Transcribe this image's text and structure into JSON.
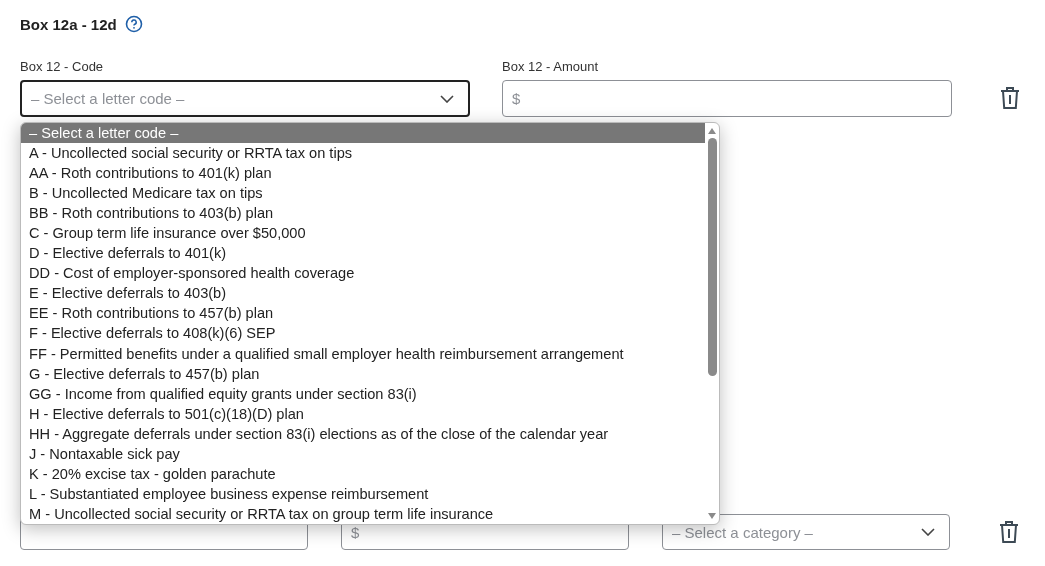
{
  "section": {
    "title": "Box 12a - 12d"
  },
  "code_field": {
    "label": "Box 12 - Code",
    "placeholder": "– Select a letter code –",
    "expanded": true
  },
  "amount_field": {
    "label": "Box 12 - Amount",
    "placeholder": "$"
  },
  "dropdown": {
    "options": [
      {
        "label": "– Select a letter code –",
        "selected": true
      },
      {
        "label": "A - Uncollected social security or RRTA tax on tips",
        "selected": false
      },
      {
        "label": "AA - Roth contributions to 401(k) plan",
        "selected": false
      },
      {
        "label": "B - Uncollected Medicare tax on tips",
        "selected": false
      },
      {
        "label": "BB - Roth contributions to 403(b) plan",
        "selected": false
      },
      {
        "label": "C - Group term life insurance over $50,000",
        "selected": false
      },
      {
        "label": "D - Elective deferrals to 401(k)",
        "selected": false
      },
      {
        "label": "DD - Cost of employer-sponsored health coverage",
        "selected": false
      },
      {
        "label": "E - Elective deferrals to 403(b)",
        "selected": false
      },
      {
        "label": "EE - Roth contributions to 457(b) plan",
        "selected": false
      },
      {
        "label": "F - Elective deferrals to 408(k)(6) SEP",
        "selected": false
      },
      {
        "label": "FF - Permitted benefits under a qualified small employer health reimbursement arrangement",
        "selected": false
      },
      {
        "label": "G - Elective deferrals to 457(b) plan",
        "selected": false
      },
      {
        "label": "GG - Income from qualified equity grants under section 83(i)",
        "selected": false
      },
      {
        "label": "H - Elective deferrals to 501(c)(18)(D) plan",
        "selected": false
      },
      {
        "label": "HH - Aggregate deferrals under section 83(i) elections as of the close of the calendar year",
        "selected": false
      },
      {
        "label": "J - Nontaxable sick pay",
        "selected": false
      },
      {
        "label": "K - 20% excise tax - golden parachute",
        "selected": false
      },
      {
        "label": "L - Substantiated employee business expense reimbursement",
        "selected": false
      },
      {
        "label": "M - Uncollected social security or RRTA tax on group term life insurance",
        "selected": false
      }
    ]
  },
  "bottom_row": {
    "amount_placeholder": "$",
    "category_placeholder": "– Select a category –"
  }
}
